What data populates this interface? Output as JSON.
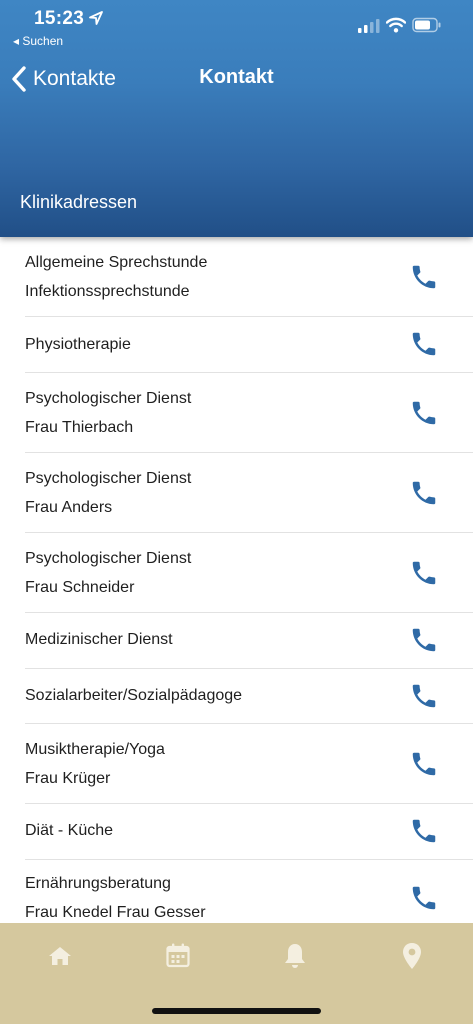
{
  "status_bar": {
    "time": "15:23",
    "back_app": "◂ Suchen"
  },
  "nav": {
    "back_label": "Kontakte",
    "title": "Kontakt"
  },
  "section": {
    "title": "Klinikadressen"
  },
  "contacts": [
    {
      "line1": "Allgemeine Sprechstunde",
      "line2": "Infektionssprechstunde"
    },
    {
      "line1": "Physiotherapie",
      "line2": ""
    },
    {
      "line1": "Psychologischer Dienst",
      "line2": "Frau Thierbach"
    },
    {
      "line1": "Psychologischer Dienst",
      "line2": "Frau Anders"
    },
    {
      "line1": "Psychologischer Dienst",
      "line2": "Frau Schneider"
    },
    {
      "line1": "Medizinischer Dienst",
      "line2": ""
    },
    {
      "line1": "Sozialarbeiter/Sozialpädagoge",
      "line2": ""
    },
    {
      "line1": "Musiktherapie/Yoga",
      "line2": "Frau Krüger"
    },
    {
      "line1": "Diät - Küche",
      "line2": ""
    },
    {
      "line1": "Ernährungsberatung",
      "line2": "Frau Knedel Frau Gesser"
    }
  ],
  "tabs": [
    {
      "icon": "home-icon"
    },
    {
      "icon": "calendar-icon"
    },
    {
      "icon": "bell-icon"
    },
    {
      "icon": "location-pin-icon"
    }
  ],
  "colors": {
    "header_top": "#3f86c4",
    "header_bottom": "#214f87",
    "phone_icon": "#2f6aa6",
    "tabbar_bg": "#d5c89e",
    "tab_icon": "#f4efe0"
  }
}
